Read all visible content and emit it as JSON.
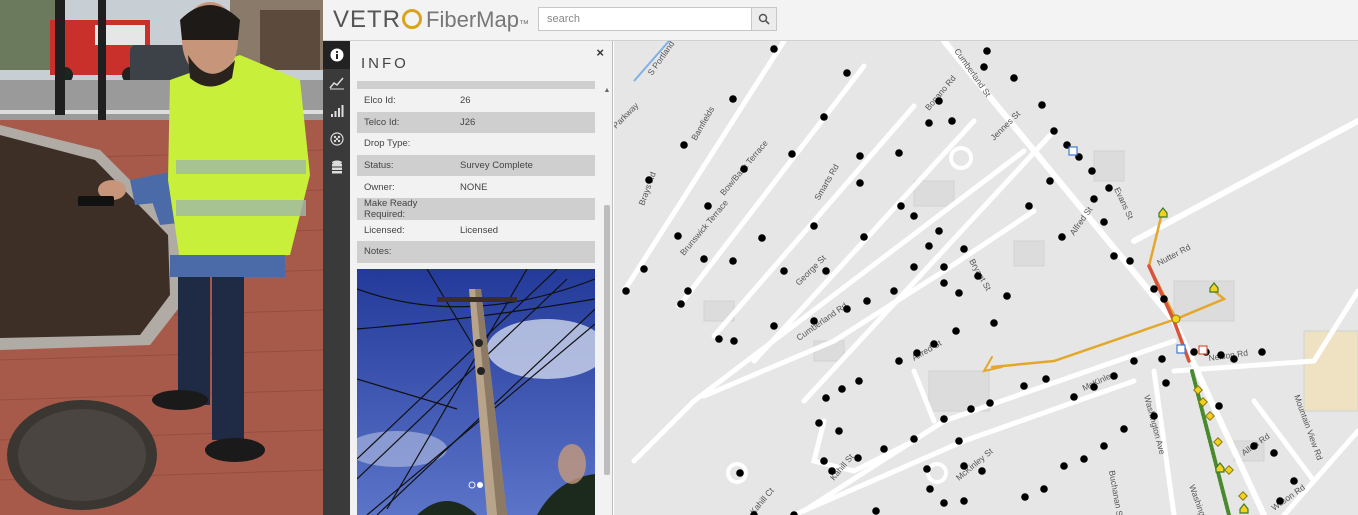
{
  "app": {
    "logo_vetro_a": "VETR",
    "logo_fiber": "FiberMap",
    "logo_tm": "™"
  },
  "search": {
    "placeholder": "search"
  },
  "sidebar": {
    "icons": [
      "info-icon",
      "line-chart-icon",
      "signal-bars-icon",
      "cable-icon",
      "database-icon"
    ]
  },
  "info_panel": {
    "title": "INFO",
    "close_label": "×",
    "properties": [
      {
        "key": "Elco Id:",
        "value": "26"
      },
      {
        "key": "Telco Id:",
        "value": "J26"
      },
      {
        "key": "Drop Type:",
        "value": ""
      },
      {
        "key": "Status:",
        "value": "Survey Complete"
      },
      {
        "key": "Owner:",
        "value": "NONE"
      },
      {
        "key": "Make Ready Required:",
        "value": ""
      },
      {
        "key": "Licensed:",
        "value": "Licensed"
      },
      {
        "key": "Notes:",
        "value": ""
      }
    ],
    "photo_page": 2,
    "photo_count": 2
  },
  "map": {
    "streets": [
      "S Portland Green",
      "Parkway",
      "Brays Rd",
      "Bamfields",
      "Bow/Bank Terrace",
      "Brunswick Terrace",
      "Smarts Rd",
      "Bonano Rd",
      "Cumberland St",
      "Jennes St",
      "Alfred St",
      "Evans St",
      "Nutter Rd",
      "Nelson Rd",
      "George St",
      "Cumberland Rd",
      "Bryant St",
      "McKinley",
      "Mountain View Rd",
      "Allen Rd",
      "Washington Ave",
      "McKinley St",
      "Alfred St",
      "Kahill Ct",
      "Buchanan St",
      "Washington St",
      "Wilson Rd",
      "Kahill St"
    ],
    "colors": {
      "drop_line": "#e4a72a",
      "fiber_route": "#d9543a",
      "survey_green": "#4a8a2e",
      "pole": "#000000",
      "node": "#f2d21d"
    }
  }
}
